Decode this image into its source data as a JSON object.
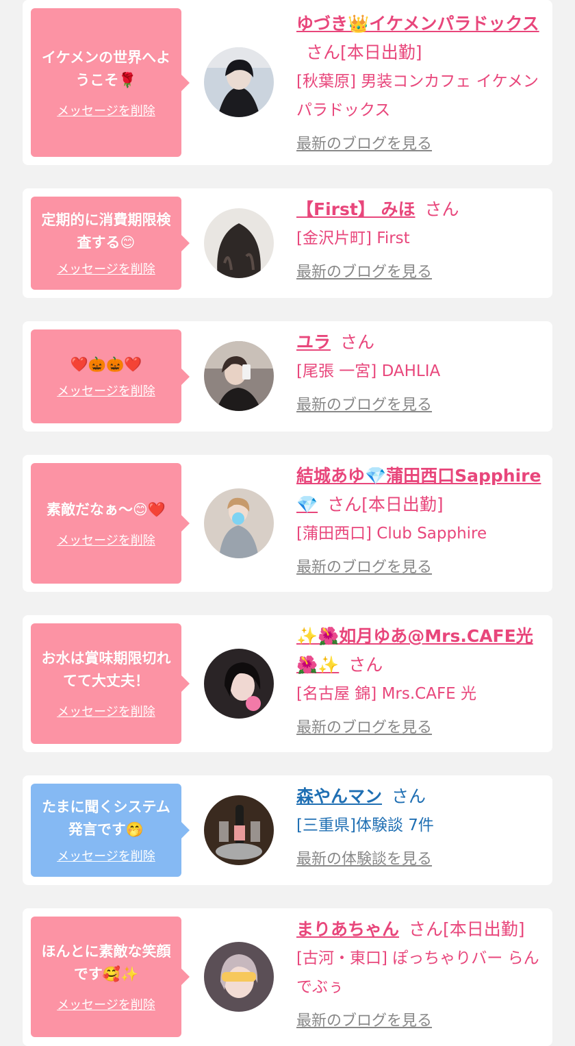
{
  "delete_label": "メッセージを削除",
  "cards": [
    {
      "message": "イケメンの世界へようこそ🌹",
      "name": "ゆづき👑イケメンパラドックス",
      "suffix": "さん[本日出勤]",
      "shop": "[秋葉原] 男装コンカフェ イケメンパラドックス",
      "link": "最新のブログを見る",
      "theme": "pink"
    },
    {
      "message": "定期的に消費期限検査する😊",
      "name": "【First】 みほ",
      "suffix": "さん",
      "shop": "[金沢片町] First",
      "link": "最新のブログを見る",
      "theme": "pink"
    },
    {
      "message": "❤️🎃🎃❤️",
      "name": "ユラ",
      "suffix": "さん",
      "shop": "[尾張 一宮] DAHLIA",
      "link": "最新のブログを見る",
      "theme": "pink"
    },
    {
      "message": "素敵だなぁ～😊❤️",
      "name": "結城あゆ💎蒲田西口Sapphire💎",
      "suffix": "さん[本日出勤]",
      "shop": "[蒲田西口] Club Sapphire",
      "link": "最新のブログを見る",
      "theme": "pink"
    },
    {
      "message": "お水は賞味期限切れてて大丈夫！",
      "name": "✨🌺如月ゆあ@Mrs.CAFE光🌺✨",
      "suffix": "さん",
      "shop": "[名古屋 錦] Mrs.CAFE 光",
      "link": "最新のブログを見る",
      "theme": "pink"
    },
    {
      "message": "たまに聞くシステム発言です🤭",
      "name": "森やんマン",
      "suffix": "さん",
      "shop": "[三重県]体験談 7件",
      "link": "最新の体験談を見る",
      "theme": "blue"
    },
    {
      "message": "ほんとに素敵な笑顔です🥰✨",
      "name": "まりあちゃん",
      "suffix": "さん[本日出勤]",
      "shop": "[古河・東口] ぽっちゃりバー らんでぶぅ",
      "link": "最新のブログを見る",
      "theme": "pink"
    }
  ],
  "avatar_colors": [
    "#1d1d22",
    "#3b3431",
    "#6c5e55",
    "#d9c7b8",
    "#2d2428",
    "#3e2b22",
    "#5a4d54"
  ]
}
